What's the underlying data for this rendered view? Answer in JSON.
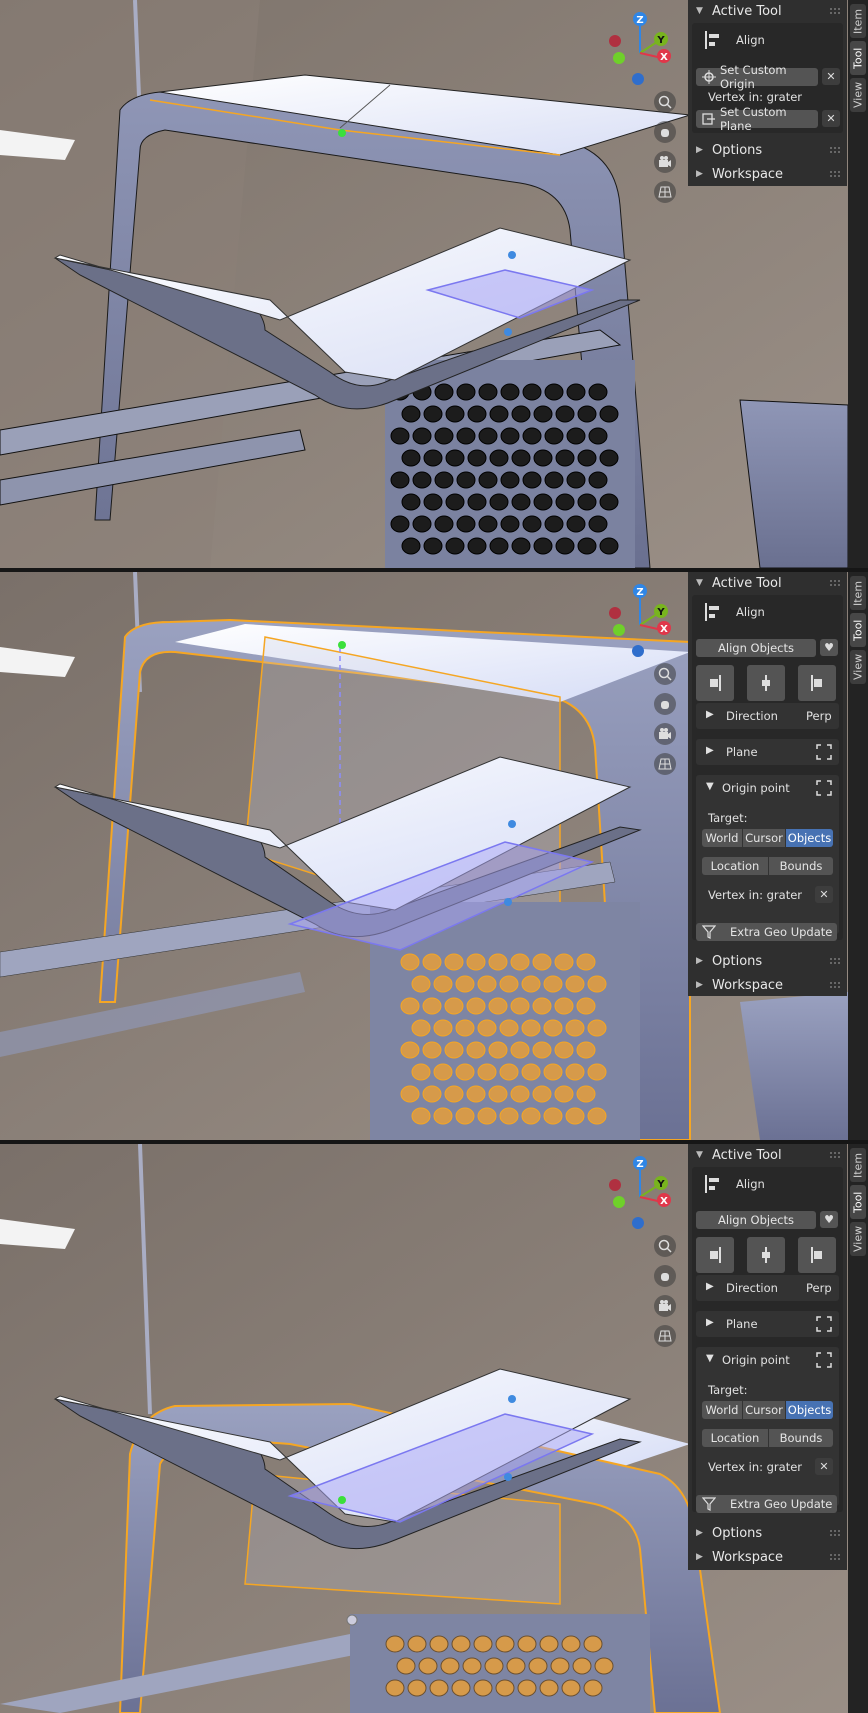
{
  "sidebar_tabs": [
    "Item",
    "Tool",
    "View"
  ],
  "panel1": {
    "header": "Active Tool",
    "tool_name": "Align",
    "set_origin_label": "Set Custom Origin",
    "origin_value": "Vertex in: grater",
    "set_plane_label": "Set Custom Plane",
    "options_label": "Options",
    "workspace_label": "Workspace"
  },
  "panel2": {
    "header": "Active Tool",
    "tool_name": "Align",
    "align_objects_label": "Align Objects",
    "direction_label": "Direction",
    "direction_value": "Perp",
    "plane_label": "Plane",
    "origin_point_label": "Origin point",
    "target_label": "Target:",
    "target_options": [
      "World",
      "Cursor",
      "Objects"
    ],
    "target_selected": "Objects",
    "location_label": "Location",
    "bounds_label": "Bounds",
    "origin_value": "Vertex in: grater",
    "extra_geo_label": "Extra Geo Update",
    "options_label": "Options",
    "workspace_label": "Workspace"
  },
  "panel3": {
    "header": "Active Tool",
    "tool_name": "Align",
    "align_objects_label": "Align Objects",
    "direction_label": "Direction",
    "direction_value": "Perp",
    "plane_label": "Plane",
    "origin_point_label": "Origin point",
    "target_label": "Target:",
    "target_options": [
      "World",
      "Cursor",
      "Objects"
    ],
    "target_selected": "Objects",
    "location_label": "Location",
    "bounds_label": "Bounds",
    "origin_value": "Vertex in: grater",
    "extra_geo_label": "Extra Geo Update",
    "options_label": "Options",
    "workspace_label": "Workspace"
  },
  "gizmo": {
    "z": "Z",
    "y": "Y",
    "x": "X"
  },
  "colors": {
    "accent": "#4772b3",
    "selection_orange": "#f5a623",
    "axis_x": "#e0374a",
    "axis_y": "#78b41e",
    "axis_z": "#2f86e6"
  }
}
